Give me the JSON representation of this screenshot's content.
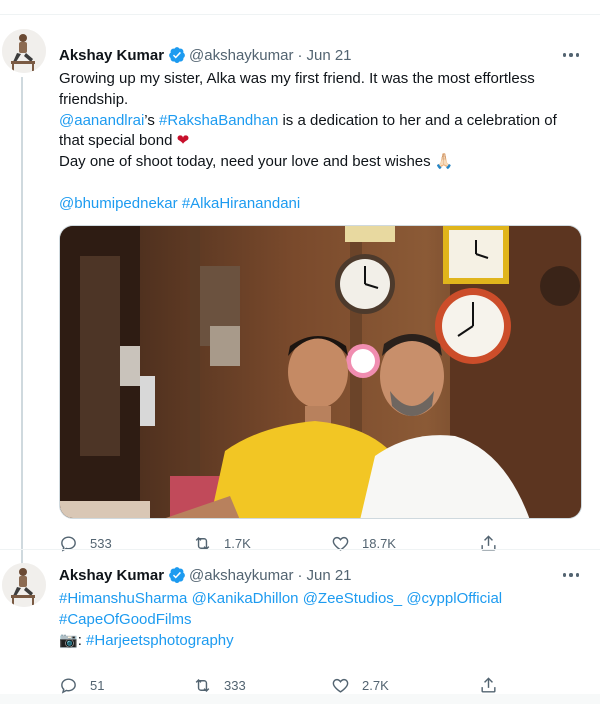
{
  "colors": {
    "link": "#1d9bf0",
    "text": "#0f1419",
    "muted": "#536471",
    "verified": "#1d9bf0",
    "heart": "#c70f2b"
  },
  "tweets": [
    {
      "author": {
        "name": "Akshay Kumar",
        "handle": "@akshaykumar",
        "separator": "·",
        "date": "Jun 21",
        "verified": true,
        "avatar_icon": "profile-photo"
      },
      "text": {
        "line1": "Growing up my sister, Alka was my first friend. It was the most effortless friendship.",
        "mention1": "@aanandlrai",
        "mid1": "’s ",
        "hashtag1": "#RakshaBandhan",
        "mid2": " is a dedication to her and a celebration of that special bond ",
        "heart_emoji": "❤",
        "line3": "Day one of shoot today, need your love and best wishes ",
        "pray_emoji": "🙏🏻",
        "mention2": "@bhumipednekar",
        "hashtag2": "#AlkaHiranandani"
      },
      "media": {
        "description_icon": "photo-two-men-clock-wall"
      },
      "stats": {
        "replies": "533",
        "retweets": "1.7K",
        "likes": "18.7K"
      }
    },
    {
      "author": {
        "name": "Akshay Kumar",
        "handle": "@akshaykumar",
        "separator": "·",
        "date": "Jun 21",
        "verified": true,
        "avatar_icon": "profile-photo"
      },
      "text": {
        "m1": "#HimanshuSharma",
        "m2": "@KanikaDhillon",
        "m3": "@ZeeStudios_",
        "m4": "@cypplOfficial",
        "h1": "#CapeOfGoodFilms",
        "camera_emoji": "📷",
        "colon": ": ",
        "h2": "#Harjeetsphotography"
      },
      "stats": {
        "replies": "51",
        "retweets": "333",
        "likes": "2.7K"
      }
    }
  ]
}
